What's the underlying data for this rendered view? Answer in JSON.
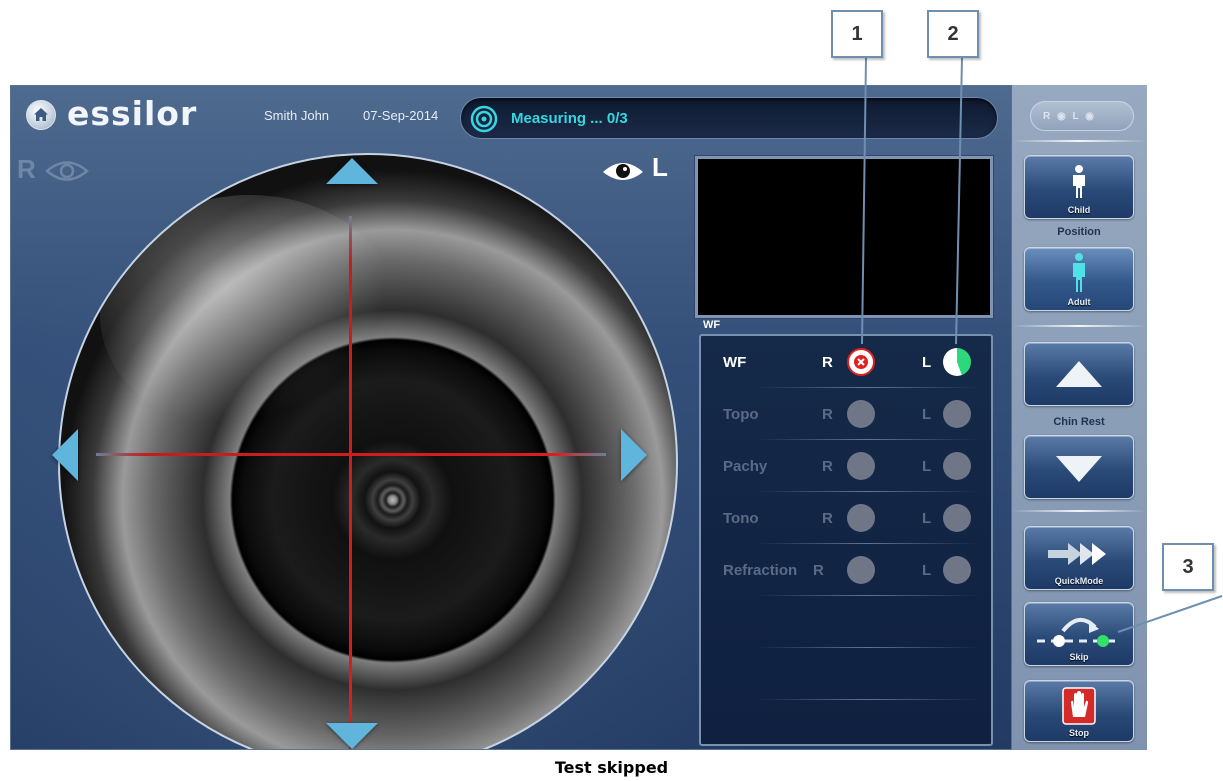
{
  "callouts": [
    "1",
    "2",
    "3"
  ],
  "header": {
    "brand": "essilor",
    "patient_name": "Smith John",
    "patient_date": "07-Sep-2014",
    "status_text": "Measuring ... 0/3"
  },
  "camera": {
    "right_eye_label": "R",
    "left_eye_label": "L"
  },
  "preview": {
    "label": "WF"
  },
  "measurements": [
    {
      "name": "WF",
      "r_label": "R",
      "l_label": "L",
      "r_state": "failed",
      "l_state": "in-progress"
    },
    {
      "name": "Topo",
      "r_label": "R",
      "l_label": "L",
      "r_state": "pending",
      "l_state": "pending"
    },
    {
      "name": "Pachy",
      "r_label": "R",
      "l_label": "L",
      "r_state": "pending",
      "l_state": "pending"
    },
    {
      "name": "Tono",
      "r_label": "R",
      "l_label": "L",
      "r_state": "pending",
      "l_state": "pending"
    },
    {
      "name": "Refraction",
      "r_label": "R",
      "l_label": "L",
      "r_state": "pending",
      "l_state": "pending"
    }
  ],
  "controls": {
    "child_label": "Child",
    "position_label": "Position",
    "adult_label": "Adult",
    "chin_rest_label": "Chin Rest",
    "quickmode_label": "QuickMode",
    "skip_label": "Skip",
    "stop_label": "Stop",
    "eye_toggle_label": "R ◉ L ◉"
  },
  "caption": "Test skipped",
  "colors": {
    "status_text": "#35d7e0",
    "crosshair": "#d81f1f",
    "fail": "#e0201e",
    "progress": "#2bd87c",
    "arrow": "#5fb5dc"
  }
}
